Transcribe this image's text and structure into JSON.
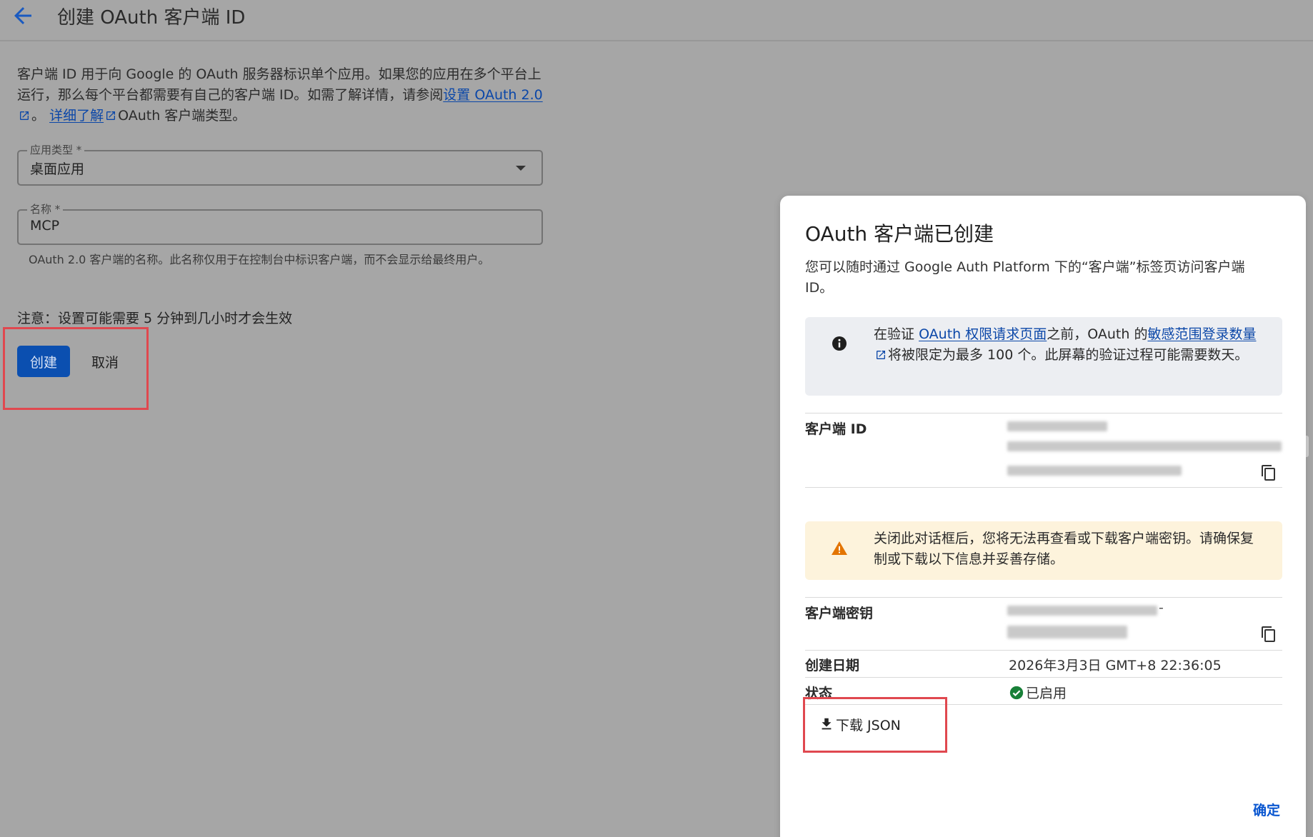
{
  "header": {
    "title": "创建 OAuth 客户端 ID",
    "back_icon": "arrow-left-icon"
  },
  "intro": {
    "text_1": "客户端 ID 用于向 Google 的 OAuth 服务器标识单个应用。如果您的应用在多个平台上运行，那么每个平台都需要有自己的客户端 ID。如需了解详情，请参阅",
    "link_setup": "设置 OAuth 2.0",
    "text_2": "。",
    "link_learn_more": "详细了解",
    "text_3": "OAuth 客户端类型。"
  },
  "form": {
    "app_type_label": "应用类型 *",
    "app_type_value": "桌面应用",
    "name_label": "名称 *",
    "name_value": "MCP",
    "name_hint": "OAuth 2.0 客户端的名称。此名称仅用于在控制台中标识客户端，而不会显示给最终用户。",
    "note": "注意：设置可能需要 5 分钟到几小时才会生效",
    "create_label": "创建",
    "cancel_label": "取消"
  },
  "dialog": {
    "title": "OAuth 客户端已创建",
    "description": "您可以随时通过 Google Auth Platform 下的“客户端”标签页访问客户端 ID。",
    "info_banner": {
      "icon": "info-icon",
      "text_1": "在验证",
      "link_consent": "OAuth 权限请求页面",
      "text_2": "之前，OAuth 的",
      "link_scopes": "敏感范围登录数量",
      "text_3": "将被限定为最多 100 个。此屏幕的验证过程可能需要数天。"
    },
    "client_id_label": "客户端 ID",
    "warning_banner": {
      "icon": "warning-icon",
      "text": "关闭此对话框后，您将无法再查看或下载客户端密钥。请确保复制或下载以下信息并妥善存储。"
    },
    "client_secret_label": "客户端密钥",
    "client_secret_visible_fragment": "-",
    "created_label": "创建日期",
    "created_value": "2026年3月3日 GMT+8 22:36:05",
    "status_label": "状态",
    "status_value": "已启用",
    "download_label": "下载 JSON",
    "ok_label": "确定"
  },
  "colors": {
    "primary": "#0b57d0",
    "highlight": "#e0484f",
    "success": "#188038",
    "warning": "#e37400"
  }
}
